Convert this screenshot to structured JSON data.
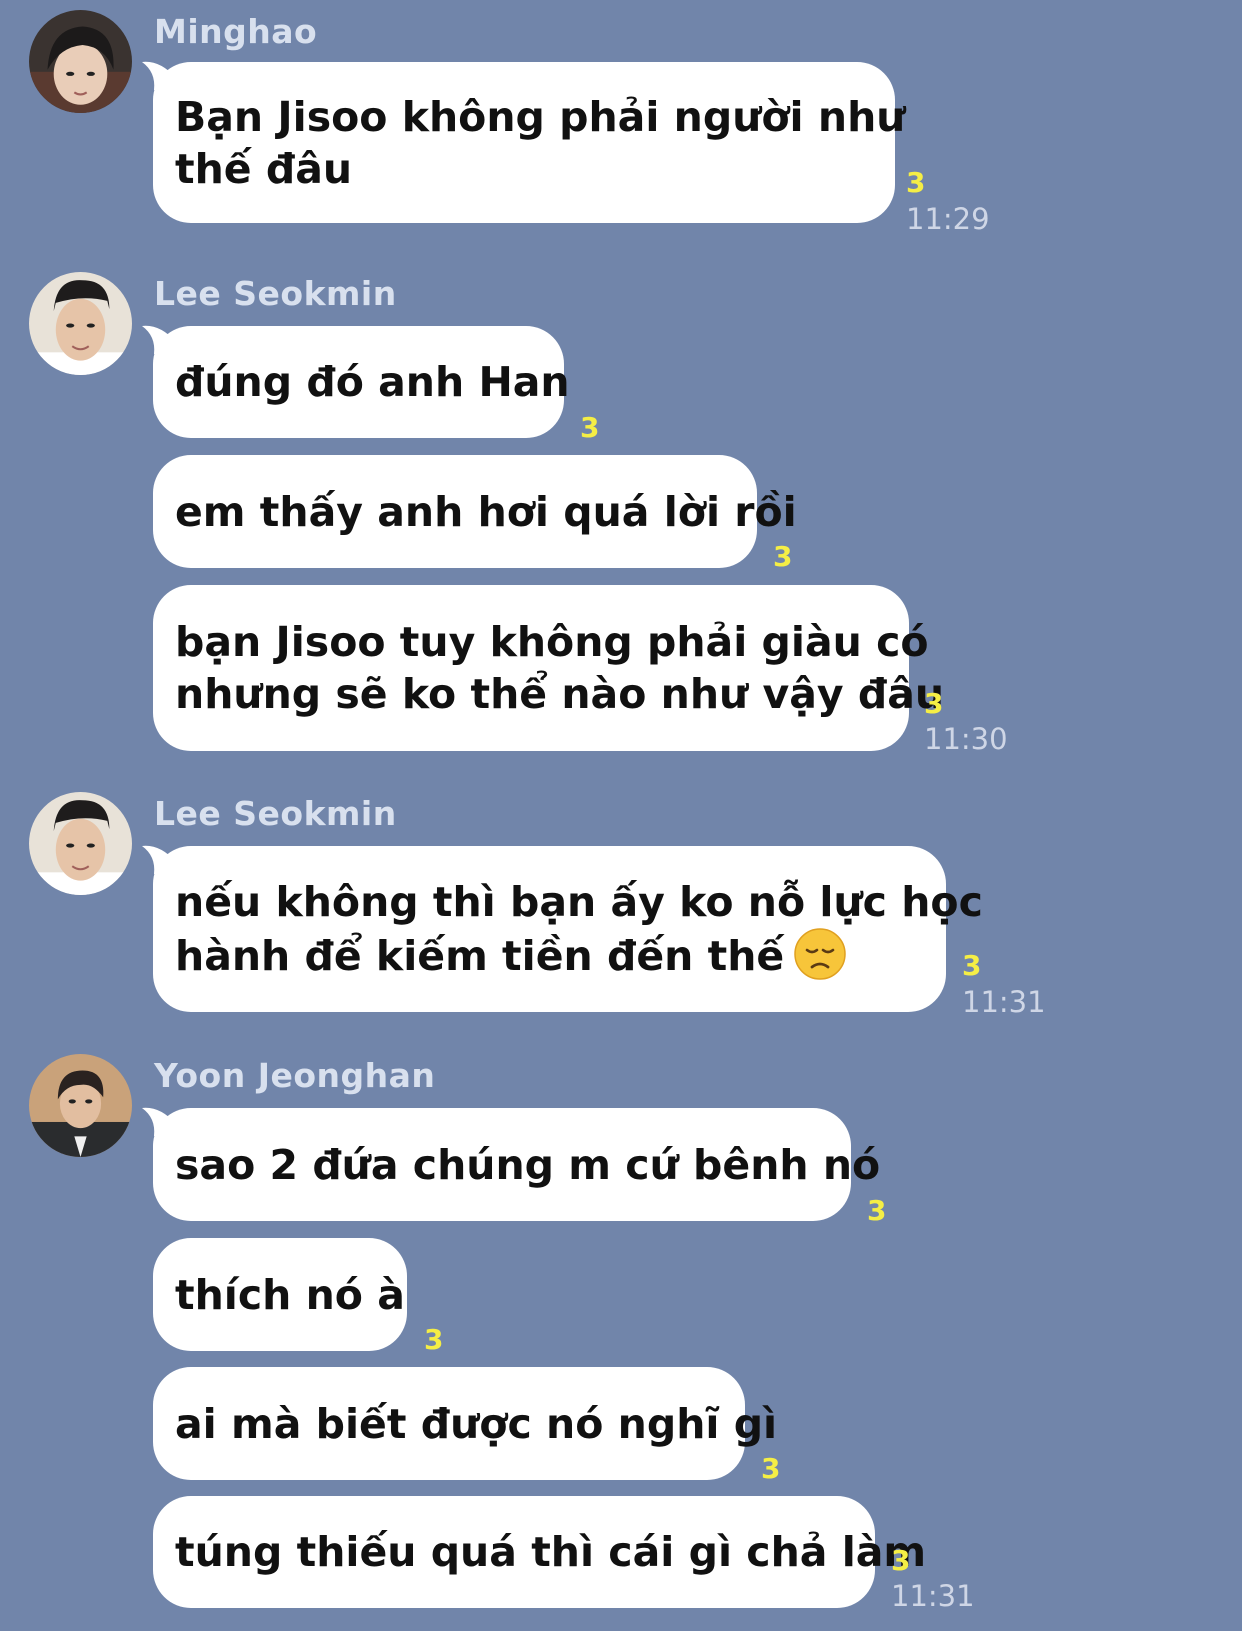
{
  "chat": {
    "read_color": "#f5ee45",
    "groups": [
      {
        "sender": "Minghao",
        "avatar": "avatar-minghao",
        "messages": [
          {
            "lines": [
              "Bạn Jisoo không phải người như",
              "thế đâu"
            ],
            "read": "3",
            "time": "11:29"
          }
        ]
      },
      {
        "sender": "Lee Seokmin",
        "avatar": "avatar-lee-seokmin",
        "messages": [
          {
            "lines": [
              "đúng đó anh Han"
            ],
            "read": "3"
          },
          {
            "lines": [
              "em thấy anh hơi quá lời rồi"
            ],
            "read": "3"
          },
          {
            "lines": [
              "bạn Jisoo tuy không phải giàu có",
              "nhưng sẽ ko thể nào như vậy đâu"
            ],
            "read": "3",
            "time": "11:30"
          }
        ]
      },
      {
        "sender": "Lee Seokmin",
        "avatar": "avatar-lee-seokmin",
        "messages": [
          {
            "lines": [
              "nếu không thì bạn ấy ko nỗ lực học",
              "hành để kiếm tiền đến thế"
            ],
            "emoji": "disappointed-face-emoji",
            "read": "3",
            "time": "11:31"
          }
        ]
      },
      {
        "sender": "Yoon Jeonghan",
        "avatar": "avatar-yoon-jeonghan",
        "messages": [
          {
            "lines": [
              "sao 2 đứa chúng m cứ bênh nó"
            ],
            "read": "3"
          },
          {
            "lines": [
              "thích nó à"
            ],
            "read": "3"
          },
          {
            "lines": [
              "ai mà biết được nó nghĩ gì"
            ],
            "read": "3"
          },
          {
            "lines": [
              "túng thiếu quá thì cái gì chả làm"
            ],
            "read": "3",
            "time": "11:31"
          }
        ]
      }
    ]
  }
}
